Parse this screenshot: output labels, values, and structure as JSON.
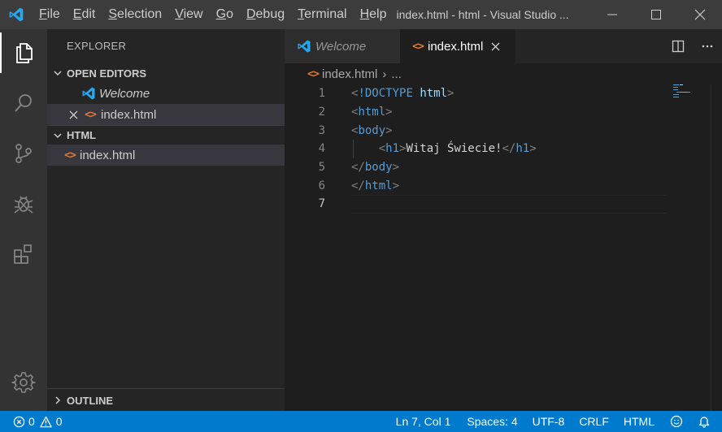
{
  "window": {
    "title": "index.html - html - Visual Studio ...",
    "logo_icon": "vscode-logo-icon",
    "controls": [
      "minimize-icon",
      "maximize-icon",
      "close-icon"
    ]
  },
  "menu": {
    "file": {
      "mn": "F",
      "rest": "ile"
    },
    "edit": {
      "mn": "E",
      "rest": "dit"
    },
    "selection": {
      "mn": "S",
      "rest": "election"
    },
    "view": {
      "mn": "V",
      "rest": "iew"
    },
    "go": {
      "mn": "G",
      "rest": "o"
    },
    "debug": {
      "mn": "D",
      "rest": "ebug"
    },
    "terminal": {
      "mn": "T",
      "rest": "erminal"
    },
    "help": {
      "mn": "H",
      "rest": "elp"
    }
  },
  "activity_bar": {
    "items": [
      "explorer-icon",
      "search-icon",
      "source-control-icon",
      "debug-icon",
      "extensions-icon"
    ],
    "bottom": "settings-gear-icon"
  },
  "sidebar": {
    "title": "EXPLORER",
    "open_editors": {
      "header": "OPEN EDITORS",
      "items": [
        {
          "label": "Welcome"
        },
        {
          "label": "index.html"
        }
      ]
    },
    "folder": {
      "header": "HTML",
      "files": [
        {
          "label": "index.html"
        }
      ]
    },
    "outline": {
      "header": "OUTLINE"
    }
  },
  "tabs": [
    {
      "label": "Welcome",
      "active": false
    },
    {
      "label": "index.html",
      "active": true
    }
  ],
  "tab_actions": [
    "split-editor-icon",
    "more-actions-icon"
  ],
  "breadcrumbs": {
    "file": "index.html",
    "separator": "›",
    "rest": "..."
  },
  "editor": {
    "lines": [
      {
        "n": "1",
        "parts": [
          [
            "bracket",
            "<"
          ],
          [
            "doctype",
            "!DOCTYPE"
          ],
          [
            "text",
            " "
          ],
          [
            "attr",
            "html"
          ],
          [
            "bracket",
            ">"
          ]
        ]
      },
      {
        "n": "2",
        "parts": [
          [
            "bracket",
            "<"
          ],
          [
            "tag",
            "html"
          ],
          [
            "bracket",
            ">"
          ]
        ]
      },
      {
        "n": "3",
        "parts": [
          [
            "bracket",
            "<"
          ],
          [
            "tag",
            "body"
          ],
          [
            "bracket",
            ">"
          ]
        ]
      },
      {
        "n": "4",
        "parts": [
          [
            "text",
            "    "
          ],
          [
            "bracket",
            "<"
          ],
          [
            "tag",
            "h1"
          ],
          [
            "bracket",
            ">"
          ],
          [
            "text",
            "Witaj Świecie!"
          ],
          [
            "bracket",
            "</"
          ],
          [
            "tag",
            "h1"
          ],
          [
            "bracket",
            ">"
          ]
        ]
      },
      {
        "n": "5",
        "parts": [
          [
            "bracket",
            "</"
          ],
          [
            "tag",
            "body"
          ],
          [
            "bracket",
            ">"
          ]
        ]
      },
      {
        "n": "6",
        "parts": [
          [
            "bracket",
            "</"
          ],
          [
            "tag",
            "html"
          ],
          [
            "bracket",
            ">"
          ]
        ]
      },
      {
        "n": "7",
        "parts": []
      }
    ],
    "current_line": "7"
  },
  "status": {
    "errors": "0",
    "warnings": "0",
    "position": "Ln 7, Col 1",
    "spaces": "Spaces: 4",
    "encoding": "UTF-8",
    "eol": "CRLF",
    "language": "HTML",
    "feedback_icon": "smiley-feedback-icon",
    "notifications_icon": "bell-icon"
  },
  "colors": {
    "accent": "#007acc",
    "html_icon": "#e37933",
    "vscode_blue": "#23a9f2"
  }
}
